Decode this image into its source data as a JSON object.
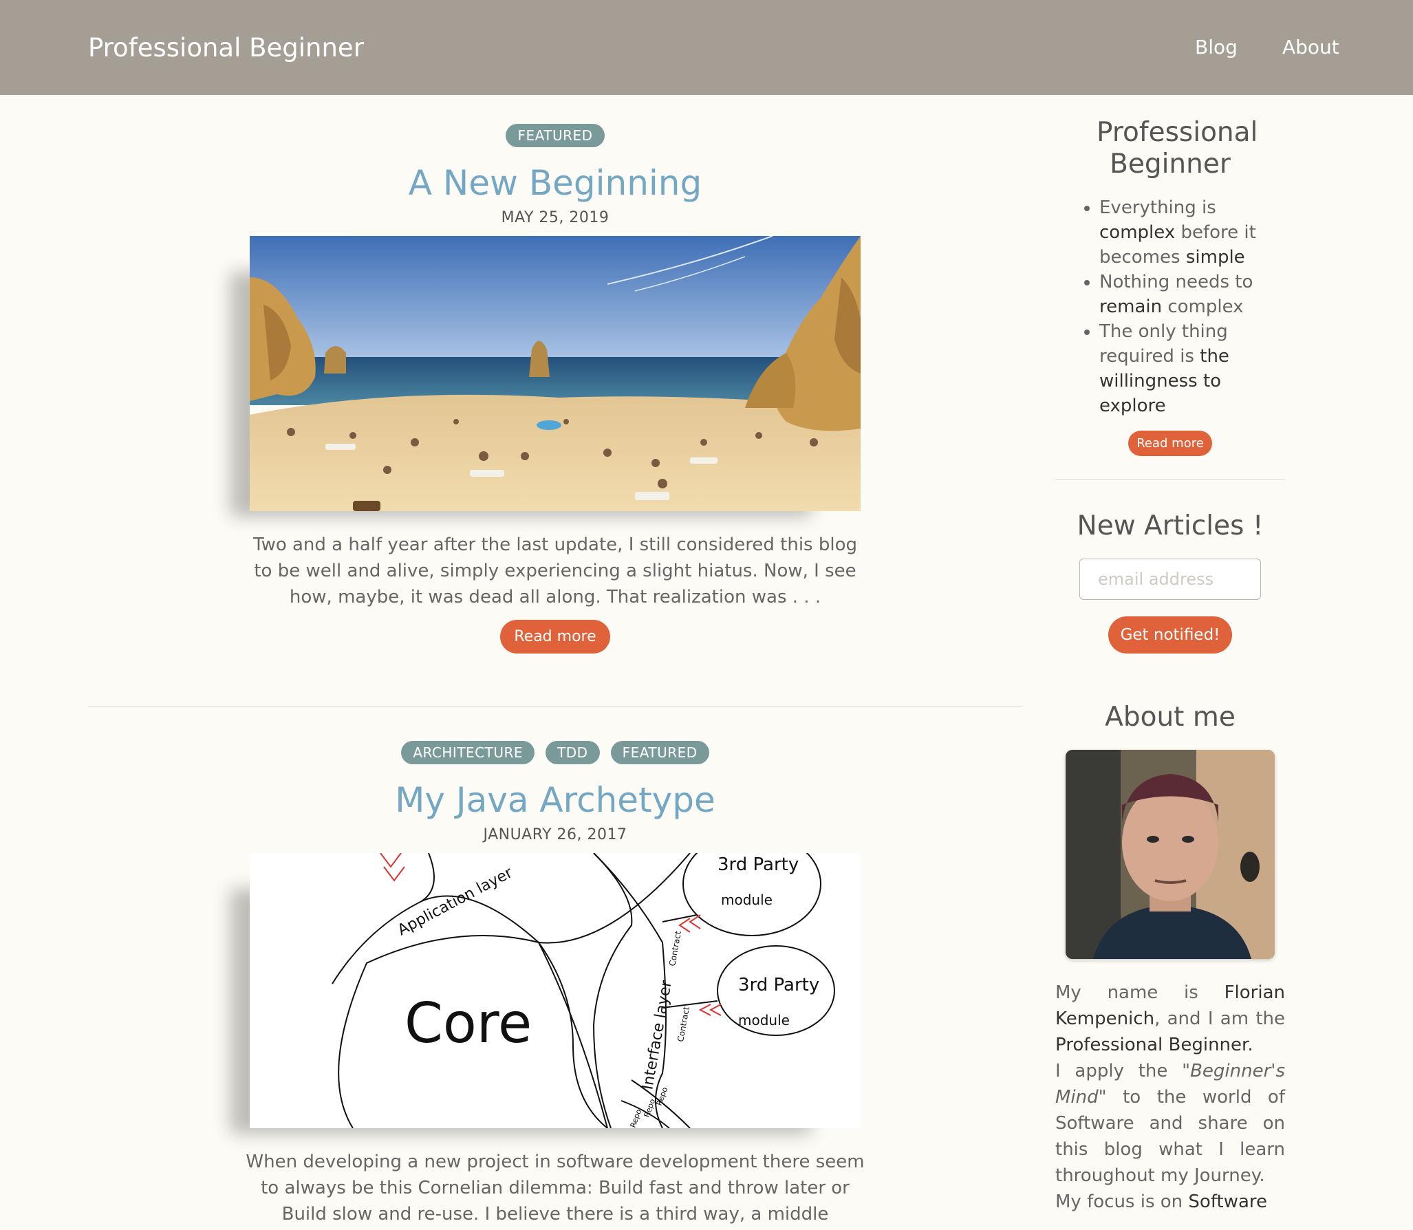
{
  "header": {
    "brand": "Professional Beginner",
    "nav": [
      {
        "label": "Blog"
      },
      {
        "label": "About"
      }
    ]
  },
  "posts": [
    {
      "tags": [
        "FEATURED"
      ],
      "title": "A New Beginning",
      "date": "MAY 25, 2019",
      "image": "beach-photo",
      "excerpt": "Two and a half year after the last update, I still considered this blog to be well and alive, simply experiencing a slight hiatus. Now, I see how, maybe, it was dead all along. That realization was . . .",
      "read_more": "Read more"
    },
    {
      "tags": [
        "ARCHITECTURE",
        "TDD",
        "FEATURED"
      ],
      "title": "My Java Archetype",
      "date": "JANUARY 26, 2017",
      "image": "architecture-sketch",
      "diagram_labels": {
        "app_layer": "Application layer",
        "core": "Core",
        "interface_layer": "Interface layer",
        "third_party_1": "3rd Party",
        "third_party_2": "3rd Party",
        "module_1": "module",
        "module_2": "module",
        "contract_1": "Contract",
        "contract_2": "Contract",
        "repos": [
          "Repo",
          "Repo",
          "Repo"
        ]
      },
      "excerpt": "When developing a new project in software development there seem to always be this Cornelian dilemma: Build fast and throw later or Build slow and re-use. I believe there is a third way, a middle"
    }
  ],
  "sidebar": {
    "intro_title": "Professional Beginner",
    "motto": [
      {
        "a": "Everything is ",
        "b": "complex",
        "c": " before it becomes ",
        "d": "simple",
        "e": ""
      },
      {
        "a": "Nothing needs to ",
        "b": "remain",
        "c": " complex",
        "d": "",
        "e": ""
      },
      {
        "a": "The only thing required is ",
        "b": "the willingness to explore",
        "c": "",
        "d": "",
        "e": ""
      }
    ],
    "intro_read_more": "Read more",
    "newsletter_title": "New Articles !",
    "email_placeholder": "email address",
    "notify_label": "Get notified!",
    "about_title": "About me",
    "bio": {
      "p1a": "My name is ",
      "p1b": "Florian Kempenich",
      "p1c": ", and I am the ",
      "p1d": "Professional Beginner.",
      "p2a": "I apply the ",
      "p2b": "\"Beginner's Mind\"",
      "p2c": " to the world of Software and share on this blog what I learn throughout my Journey.",
      "p3a": "My focus is on ",
      "p3b": "Software"
    }
  },
  "colors": {
    "header_bg": "#a59e94",
    "page_bg": "#fdfbf5",
    "accent": "#e0623a",
    "title_blue": "#74a7c4",
    "tag_bg": "#7a9a99"
  }
}
